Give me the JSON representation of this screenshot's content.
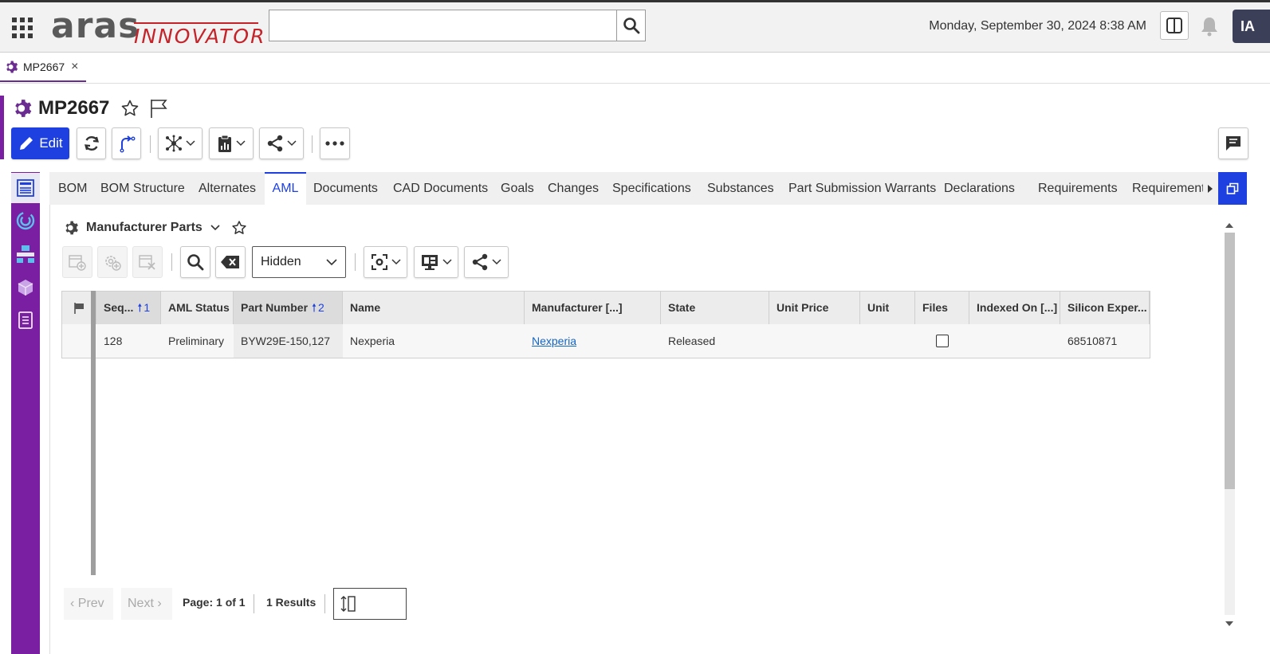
{
  "header": {
    "logo_main": "aras",
    "logo_sub": "INNOVATOR",
    "search_value": "",
    "datetime": "Monday, September 30, 2024 8:38 AM",
    "avatar_initials": "IA"
  },
  "open_tab": {
    "label": "MP2667",
    "close": "×"
  },
  "item": {
    "title": "MP2667"
  },
  "toolbar": {
    "edit_label": "Edit"
  },
  "relationship_tabs": [
    "BOM",
    "BOM Structure",
    "Alternates",
    "AML",
    "Documents",
    "CAD Documents",
    "Goals",
    "Changes",
    "Specifications",
    "Substances",
    "Part Submission Warrants",
    "Declarations",
    "Requirements",
    "Requirements"
  ],
  "active_tab": "AML",
  "relationship": {
    "title": "Manufacturer Parts",
    "view_select": "Hidden"
  },
  "grid": {
    "columns": [
      {
        "label": "Seq...",
        "sort": "1"
      },
      {
        "label": "AML Status",
        "sort": ""
      },
      {
        "label": "Part Number",
        "sort": "2"
      },
      {
        "label": "Name",
        "sort": ""
      },
      {
        "label": "Manufacturer [...]",
        "sort": ""
      },
      {
        "label": "State",
        "sort": ""
      },
      {
        "label": "Unit Price",
        "sort": ""
      },
      {
        "label": "Unit",
        "sort": ""
      },
      {
        "label": "Files",
        "sort": ""
      },
      {
        "label": "Indexed On [...]",
        "sort": ""
      },
      {
        "label": "Silicon Exper...",
        "sort": ""
      }
    ],
    "rows": [
      {
        "seq": "128",
        "aml_status": "Preliminary",
        "part_number": "BYW29E-150,127",
        "name": "Nexperia",
        "manufacturer": "Nexperia",
        "state": "Released",
        "unit_price": "",
        "unit": "",
        "files": false,
        "indexed_on": "",
        "silicon_expert": "68510871"
      }
    ]
  },
  "pagination": {
    "prev": "Prev",
    "next": "Next",
    "page": "Page: 1 of 1",
    "results": "1 Results"
  },
  "colors": {
    "accent_blue": "#1e40e0",
    "sidebar_purple": "#7b1fa2",
    "logo_red": "#c4232a"
  }
}
